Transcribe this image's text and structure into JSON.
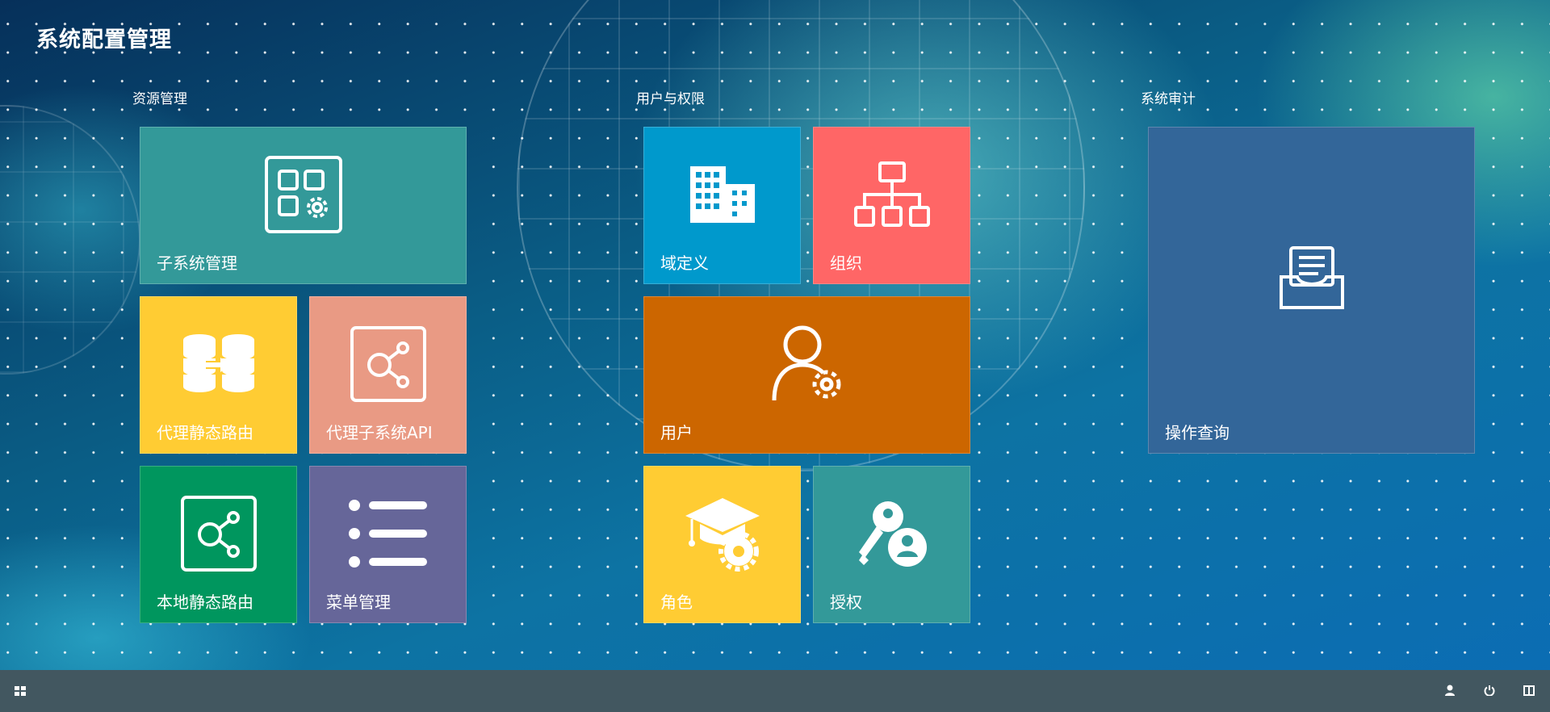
{
  "app": {
    "title": "系统配置管理"
  },
  "groups": {
    "resource": {
      "title": "资源管理",
      "tiles": {
        "subsystem": {
          "label": "子系统管理",
          "color": "#339999",
          "icon": "apps-settings-icon"
        },
        "proxy_static_route": {
          "label": "代理静态路由",
          "color": "#ffcc33",
          "icon": "database-transfer-icon"
        },
        "proxy_subsystem_api": {
          "label": "代理子系统API",
          "color": "#e99a84",
          "icon": "share-icon"
        },
        "local_static_route": {
          "label": "本地静态路由",
          "color": "#00965e",
          "icon": "share-icon"
        },
        "menu": {
          "label": "菜单管理",
          "color": "#666699",
          "icon": "list-icon"
        }
      }
    },
    "user_permission": {
      "title": "用户与权限",
      "tiles": {
        "domain": {
          "label": "域定义",
          "color": "#0099cc",
          "icon": "building-icon"
        },
        "organization": {
          "label": "组织",
          "color": "#ff6666",
          "icon": "org-chart-icon"
        },
        "user": {
          "label": "用户",
          "color": "#cc6600",
          "icon": "user-settings-icon"
        },
        "role": {
          "label": "角色",
          "color": "#ffcc33",
          "icon": "graduation-cap-gear-icon"
        },
        "authorization": {
          "label": "授权",
          "color": "#339999",
          "icon": "key-user-icon"
        }
      }
    },
    "audit": {
      "title": "系统审计",
      "tiles": {
        "operation_query": {
          "label": "操作查询",
          "color": "#336699",
          "icon": "inbox-document-icon"
        }
      }
    }
  },
  "taskbar": {
    "color": "#425760",
    "start": {
      "icon": "windows-start-icon"
    },
    "right": [
      {
        "icon": "user-icon"
      },
      {
        "icon": "power-icon"
      },
      {
        "icon": "split-view-icon"
      }
    ]
  }
}
